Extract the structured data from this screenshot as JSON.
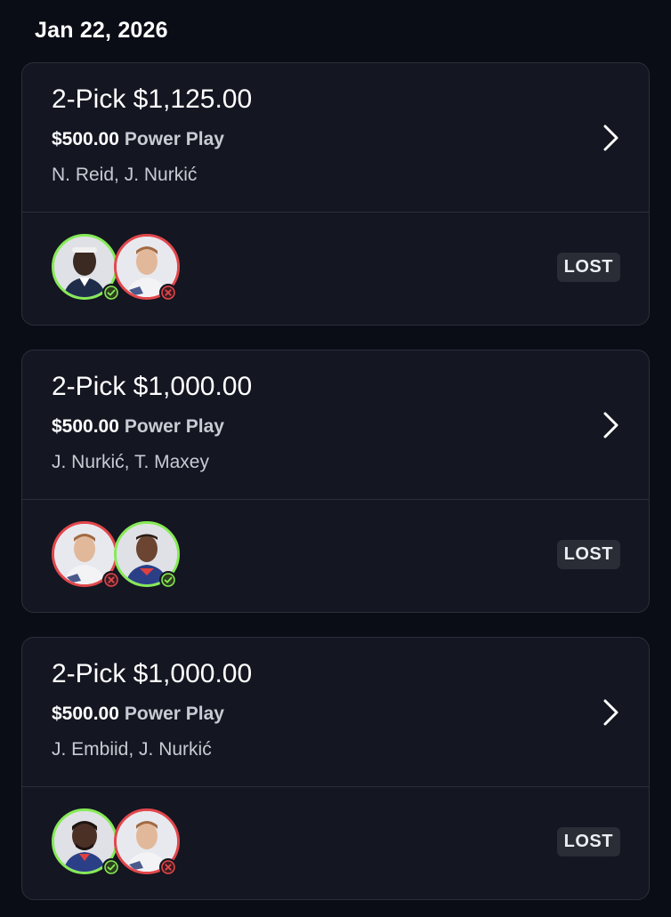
{
  "date_header": "Jan 22, 2026",
  "colors": {
    "background": "#0a0c16",
    "card": "#141621",
    "win": "#86ea57",
    "loss": "#e2474b"
  },
  "cards": [
    {
      "title": "2-Pick $1,125.00",
      "entry_amount": "$500.00",
      "entry_type": "Power Play",
      "players": "N. Reid, J. Nurkić",
      "status": "LOST",
      "picks": [
        {
          "result": "win",
          "icon": "player-avatar"
        },
        {
          "result": "loss",
          "icon": "player-avatar"
        }
      ]
    },
    {
      "title": "2-Pick $1,000.00",
      "entry_amount": "$500.00",
      "entry_type": "Power Play",
      "players": "J. Nurkić, T. Maxey",
      "status": "LOST",
      "picks": [
        {
          "result": "loss",
          "icon": "player-avatar"
        },
        {
          "result": "win",
          "icon": "player-avatar"
        }
      ]
    },
    {
      "title": "2-Pick $1,000.00",
      "entry_amount": "$500.00",
      "entry_type": "Power Play",
      "players": "J. Embiid, J. Nurkić",
      "status": "LOST",
      "picks": [
        {
          "result": "win",
          "icon": "player-avatar"
        },
        {
          "result": "loss",
          "icon": "player-avatar"
        }
      ]
    }
  ]
}
